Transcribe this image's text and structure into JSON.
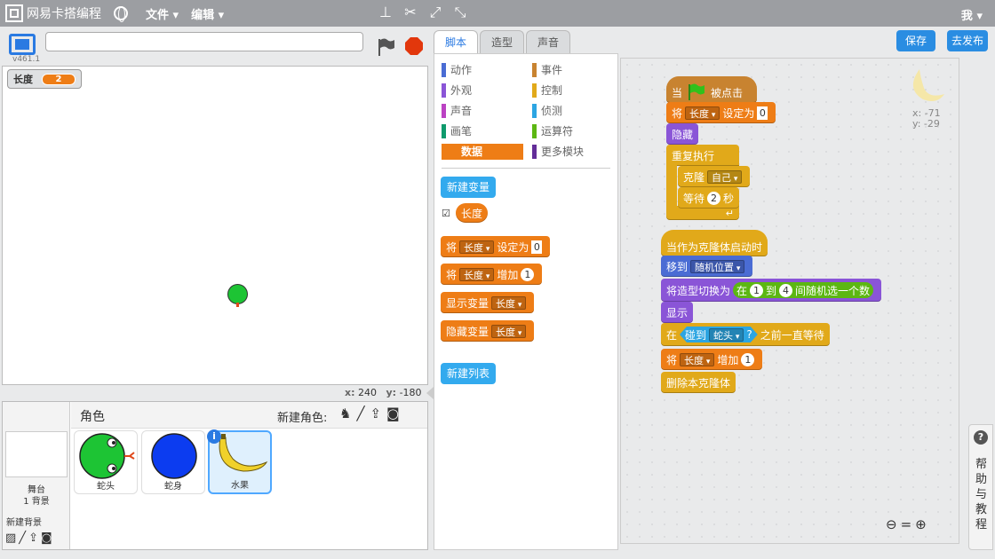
{
  "menubar": {
    "logo_text": "网易卡搭编程",
    "menu_file": "文件",
    "menu_edit": "编辑",
    "user": "我"
  },
  "stage": {
    "version": "v461.1",
    "project_title": "",
    "variable_name": "长度",
    "variable_value": "2",
    "x_label": "x:",
    "x_value": "240",
    "y_label": "y:",
    "y_value": "-180"
  },
  "sprites": {
    "header": "角色",
    "new_sprite": "新建角色:",
    "stage_label": "舞台",
    "stage_bg_count": "1 背景",
    "new_backdrop": "新建背景",
    "items": [
      {
        "name": "蛇头",
        "color": "#1dc434"
      },
      {
        "name": "蛇身",
        "color": "#0c3cf0"
      },
      {
        "name": "水果",
        "color": "#f0d12a"
      }
    ]
  },
  "tabs": {
    "scripts": "脚本",
    "costumes": "造型",
    "sounds": "声音",
    "save": "保存",
    "publish": "去发布"
  },
  "palette": {
    "categories": [
      {
        "label": "动作",
        "color": "#4a6cd4"
      },
      {
        "label": "事件",
        "color": "#c88330"
      },
      {
        "label": "外观",
        "color": "#8a55d7"
      },
      {
        "label": "控制",
        "color": "#e1a91a"
      },
      {
        "label": "声音",
        "color": "#bb42c3"
      },
      {
        "label": "侦测",
        "color": "#2ca5e2"
      },
      {
        "label": "画笔",
        "color": "#0e9a6c"
      },
      {
        "label": "运算符",
        "color": "#5cb712"
      },
      {
        "label": "数据",
        "color": "#ee7d16"
      },
      {
        "label": "更多模块",
        "color": "#632d99"
      }
    ],
    "new_variable": "新建变量",
    "variable_reporter": "长度",
    "set_var": {
      "a": "将",
      "var": "长度",
      "b": "设定为",
      "val": "0"
    },
    "change_var": {
      "a": "将",
      "var": "长度",
      "b": "增加",
      "val": "1"
    },
    "show_var": {
      "a": "显示变量",
      "var": "长度"
    },
    "hide_var": {
      "a": "隐藏变量",
      "var": "长度"
    },
    "new_list": "新建列表"
  },
  "scripts": {
    "sprite_x": "x: -71",
    "sprite_y": "y: -29",
    "s1": {
      "when": "当",
      "clicked": "被点击",
      "set_a": "将",
      "set_var": "长度",
      "set_b": "设定为",
      "set_val": "0",
      "hide": "隐藏",
      "forever": "重复执行",
      "clone": "克隆",
      "clone_target": "自己",
      "wait": "等待",
      "wait_val": "2",
      "wait_unit": "秒"
    },
    "s2": {
      "when_clone": "当作为克隆体启动时",
      "goto": "移到",
      "goto_target": "随机位置",
      "switch": "将造型切换为",
      "pick_in": "在",
      "pick_from": "1",
      "pick_to_label": "到",
      "pick_to": "4",
      "pick_rest": "间随机选一个数",
      "show": "显示",
      "wait_in": "在",
      "touching": "碰到",
      "touch_target": "蛇头",
      "q": "?",
      "wait_until": "之前一直等待",
      "change_a": "将",
      "change_var": "长度",
      "change_b": "增加",
      "change_val": "1",
      "delete_clone": "删除本克隆体"
    }
  },
  "help": {
    "q": "?",
    "label": "帮助与教程"
  }
}
